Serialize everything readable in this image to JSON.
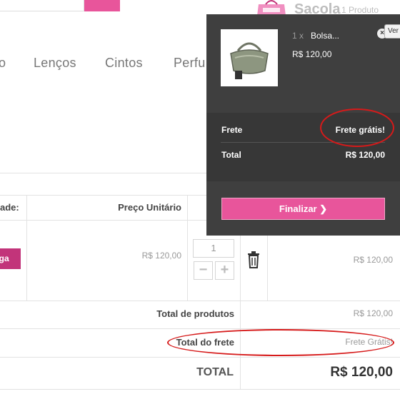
{
  "header": {
    "cart_title": "Sacola",
    "cart_count": "1 Produto"
  },
  "nav": {
    "items": [
      "o",
      "Lenços",
      "Cintos",
      "Perfu"
    ]
  },
  "table": {
    "headers": {
      "qty": "ade:",
      "unit_price": "Preço Unitário"
    },
    "row": {
      "remove_label": "ega",
      "unit_price": "R$ 120,00",
      "quantity": "1",
      "subtotal": "R$ 120,00"
    },
    "summary": {
      "products_label": "Total de produtos",
      "products_value": "R$ 120,00",
      "shipping_label": "Total do frete",
      "shipping_value": "Frete Grátis!",
      "total_label": "TOTAL",
      "total_value": "R$ 120,00"
    }
  },
  "dropdown": {
    "product_qty": "1 x",
    "product_name": "Bolsa...",
    "product_price": "R$ 120,00",
    "close_symbol": "×",
    "tooltip": "Ver",
    "shipping_label": "Frete",
    "shipping_value": "Frete grátis!",
    "total_label": "Total",
    "total_value": "R$ 120,00",
    "checkout_label": "Finalizar ❯"
  },
  "colors": {
    "accent": "#e8559b",
    "remove": "#c2347a",
    "dropdown_bg": "#3f3f3f",
    "annotation": "#d61a1a"
  }
}
